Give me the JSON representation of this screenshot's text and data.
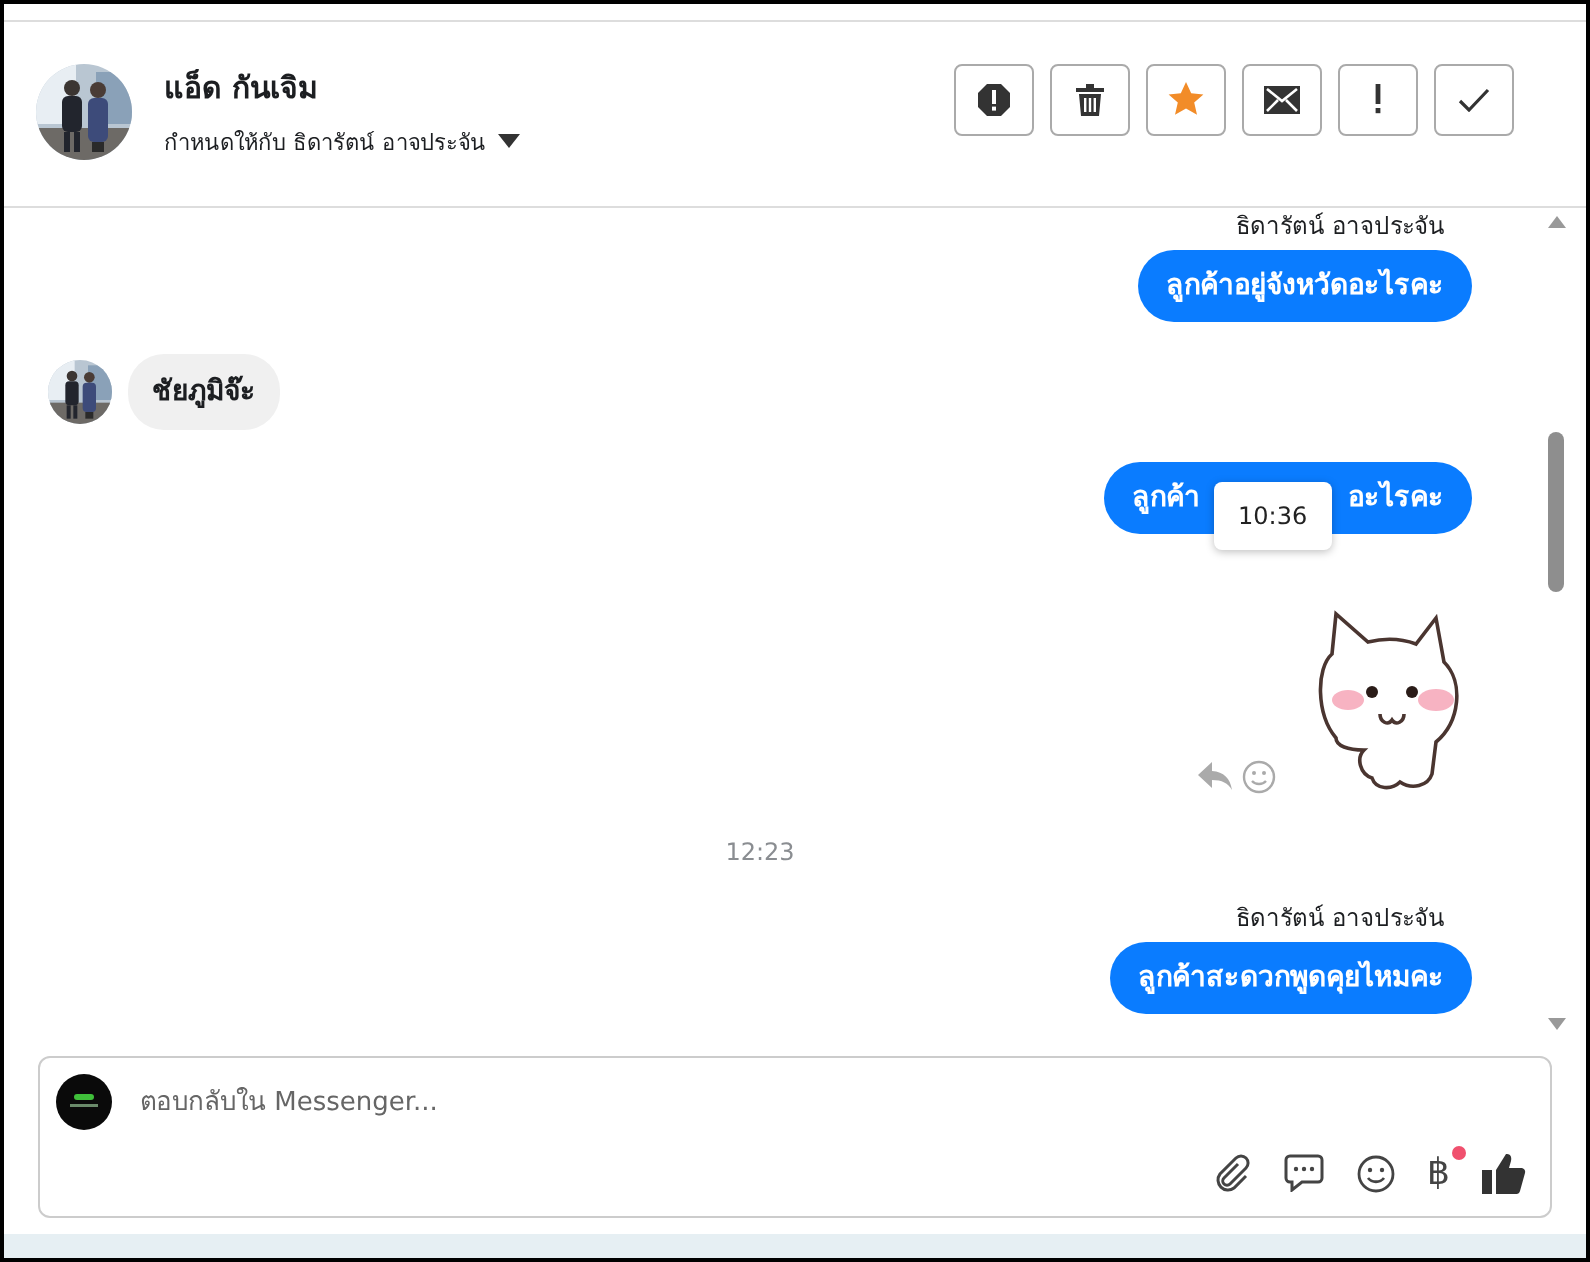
{
  "header": {
    "name": "แอ็ด กันเจิม",
    "assigned_to": "กำหนดให้กับ ธิดารัตน์ อาจประจัน",
    "actions": [
      {
        "kind": "alert",
        "on": false
      },
      {
        "kind": "delete",
        "on": false
      },
      {
        "kind": "star",
        "on": true
      },
      {
        "kind": "mail",
        "on": false
      },
      {
        "kind": "important",
        "on": false
      },
      {
        "kind": "done",
        "on": false
      }
    ]
  },
  "thread": [
    {
      "kind": "sender",
      "text": "ธิดารัตน์ อาจประจัน"
    },
    {
      "kind": "outgoing",
      "text": "ลูกค้าอยู่จังหวัดอะไรคะ"
    },
    {
      "kind": "incoming",
      "text": "ชัยภูมิจ๊ะ"
    },
    {
      "kind": "outgoing",
      "text_parts": [
        "ลูกค้า",
        "อะไรคะ"
      ],
      "tooltip": "10:36"
    },
    {
      "kind": "sticker"
    },
    {
      "kind": "time",
      "text": "12:23"
    },
    {
      "kind": "sender",
      "text": "ธิดารัตน์ อาจประจัน"
    },
    {
      "kind": "outgoing",
      "text": "ลูกค้าสะดวกพูดคุยไหมคะ"
    }
  ],
  "composer": {
    "placeholder": "ตอบกลับใน Messenger...",
    "tools": [
      {
        "kind": "attach"
      },
      {
        "kind": "message"
      },
      {
        "kind": "emoji"
      },
      {
        "kind": "currency",
        "symbol": "฿",
        "badge": true
      },
      {
        "kind": "like"
      }
    ]
  }
}
